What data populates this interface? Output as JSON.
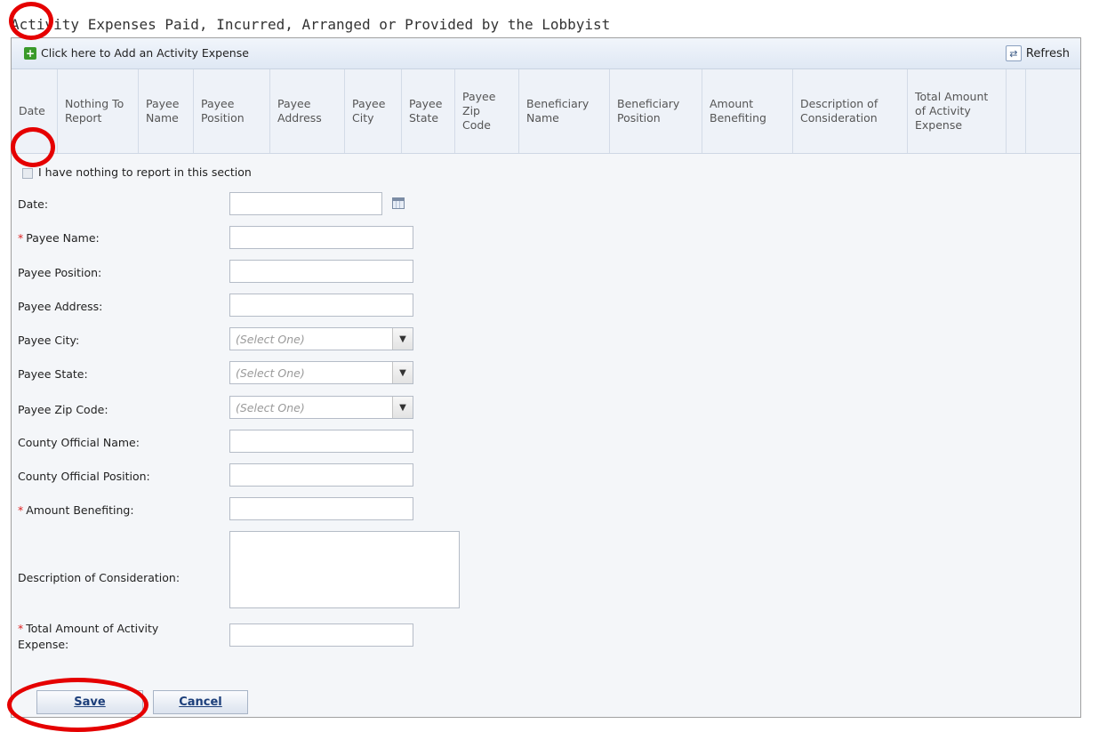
{
  "page": {
    "title": "Activity Expenses Paid, Incurred, Arranged or Provided by the Lobbyist"
  },
  "toolbar": {
    "add_label": "Click here to Add an Activity Expense",
    "refresh_label": "Refresh"
  },
  "grid": {
    "columns": [
      "Date",
      "Nothing To Report",
      "Payee Name",
      "Payee Position",
      "Payee Address",
      "Payee City",
      "Payee State",
      "Payee Zip Code",
      "Beneficiary Name",
      "Beneficiary Position",
      "Amount Benefiting",
      "Description of Consideration",
      "Total Amount of Activity Expense"
    ]
  },
  "form": {
    "nothing_label": "I have nothing to report in this section",
    "date_label": "Date:",
    "payee_name_label": "Payee Name:",
    "payee_position_label": "Payee Position:",
    "payee_address_label": "Payee Address:",
    "payee_city_label": "Payee City:",
    "payee_state_label": "Payee State:",
    "payee_zip_label": "Payee Zip Code:",
    "county_name_label": "County Official Name:",
    "county_position_label": "County Official Position:",
    "amount_label": "Amount Benefiting:",
    "description_label": "Description of Consideration:",
    "total_label_line1": "Total Amount of Activity",
    "total_label_line2": "Expense:",
    "select_placeholder": "(Select One)",
    "required_mark": "*"
  },
  "buttons": {
    "save": "Save",
    "cancel": "Cancel"
  },
  "colors": {
    "annotation": "#e50000",
    "accent": "#1c3e7a",
    "required": "#d22222"
  },
  "icons": {
    "add": "plus-icon",
    "refresh": "refresh-icon",
    "date": "calendar-icon",
    "dropdown": "chevron-down-icon"
  }
}
